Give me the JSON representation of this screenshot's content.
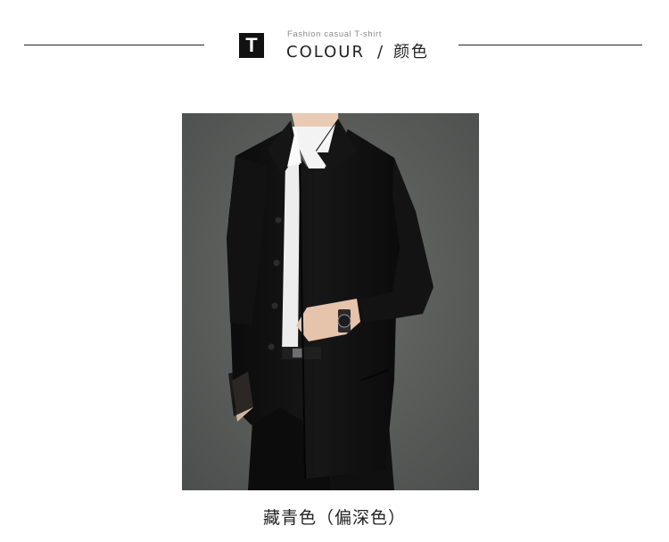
{
  "header": {
    "badge_letter": "T",
    "subtitle": "Fashion casual T-shirt",
    "title_en": "COLOUR",
    "separator": "/",
    "title_cn": "颜色"
  },
  "product": {
    "caption": "藏青色（偏深色）"
  },
  "colors": {
    "background": "#ffffff",
    "rule": "#222222",
    "badge": "#111111",
    "photo_backdrop": "#5a5d5b",
    "coat": "#0f0f10",
    "shirt": "#f2f2f2"
  }
}
